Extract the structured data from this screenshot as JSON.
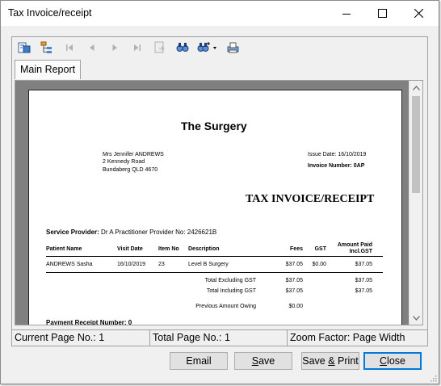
{
  "window": {
    "title": "Tax Invoice/receipt"
  },
  "tab": {
    "label": "Main Report"
  },
  "invoice": {
    "practice_name": "The Surgery",
    "patient_address": [
      "Mrs Jennifer ANDREWS",
      "2 Kennedy Road",
      "Bundaberg  QLD 4670"
    ],
    "issue_date": "Issue Date: 16/10/2019",
    "invoice_number": "Invoice Number: 0AP",
    "heading": "TAX INVOICE/RECEIPT",
    "provider_label": "Service Provider:",
    "provider_value": "Dr A Practitioner  Provider No: 2426621B",
    "columns": {
      "patient_name": "Patient Name",
      "visit_date": "Visit Date",
      "item_no": "Item No",
      "description": "Description",
      "fees": "Fees",
      "gst": "GST",
      "amount_paid": "Amount Paid",
      "amount_paid_sub": "Incl.GST"
    },
    "row": {
      "patient_name": "ANDREWS Sasha",
      "visit_date": "16/10/2019",
      "item_no": "23",
      "description": "Level B Surgery",
      "fees": "$37.05",
      "gst": "$0.00",
      "amount_paid": "$37.05"
    },
    "totals": {
      "excl_label": "Total Excluding GST",
      "excl_fees": "$37.05",
      "excl_paid": "$37.05",
      "incl_label": "Total Including GST",
      "incl_fees": "$37.05",
      "incl_paid": "$37.05",
      "prev_label": "Previous Amount Owing",
      "prev_value": "$0.00"
    },
    "payment_receipt": "Payment Receipt Number:  0"
  },
  "status": {
    "current_page": "Current Page No.: 1",
    "total_page": "Total Page No.: 1",
    "zoom": "Zoom Factor: Page Width"
  },
  "buttons": {
    "email": "Email",
    "save_prefix": "",
    "save_hot": "S",
    "save_rest": "ave",
    "save_print_a": "Save ",
    "save_print_hot": "&",
    "save_print_b": " Print",
    "close_hot": "C",
    "close_rest": "lose"
  },
  "icons": {
    "toolbar": [
      "export-icon",
      "group-tree-icon",
      "first-page-icon",
      "previous-page-icon",
      "next-page-icon",
      "last-page-icon",
      "goto-page-icon",
      "search-icon",
      "zoom-icon",
      "print-icon"
    ]
  }
}
